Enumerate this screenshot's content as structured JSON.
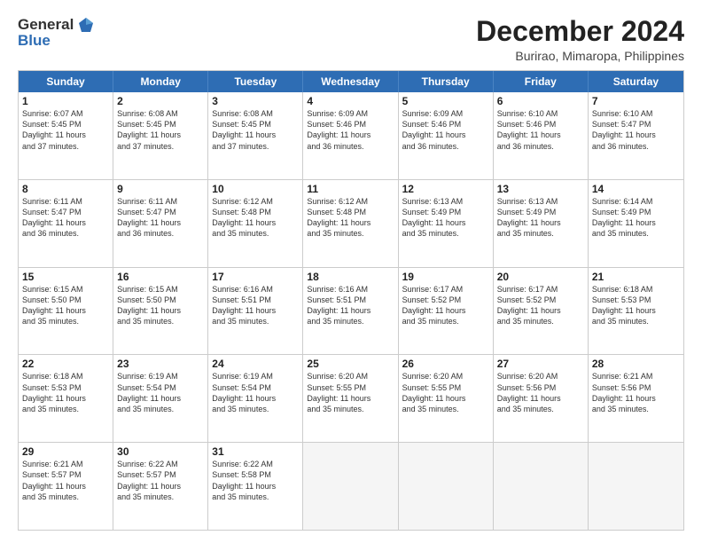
{
  "logo": {
    "general": "General",
    "blue": "Blue"
  },
  "title": "December 2024",
  "location": "Burirao, Mimaropa, Philippines",
  "days": [
    "Sunday",
    "Monday",
    "Tuesday",
    "Wednesday",
    "Thursday",
    "Friday",
    "Saturday"
  ],
  "rows": [
    [
      {
        "day": "1",
        "text": "Sunrise: 6:07 AM\nSunset: 5:45 PM\nDaylight: 11 hours\nand 37 minutes."
      },
      {
        "day": "2",
        "text": "Sunrise: 6:08 AM\nSunset: 5:45 PM\nDaylight: 11 hours\nand 37 minutes."
      },
      {
        "day": "3",
        "text": "Sunrise: 6:08 AM\nSunset: 5:45 PM\nDaylight: 11 hours\nand 37 minutes."
      },
      {
        "day": "4",
        "text": "Sunrise: 6:09 AM\nSunset: 5:46 PM\nDaylight: 11 hours\nand 36 minutes."
      },
      {
        "day": "5",
        "text": "Sunrise: 6:09 AM\nSunset: 5:46 PM\nDaylight: 11 hours\nand 36 minutes."
      },
      {
        "day": "6",
        "text": "Sunrise: 6:10 AM\nSunset: 5:46 PM\nDaylight: 11 hours\nand 36 minutes."
      },
      {
        "day": "7",
        "text": "Sunrise: 6:10 AM\nSunset: 5:47 PM\nDaylight: 11 hours\nand 36 minutes."
      }
    ],
    [
      {
        "day": "8",
        "text": "Sunrise: 6:11 AM\nSunset: 5:47 PM\nDaylight: 11 hours\nand 36 minutes."
      },
      {
        "day": "9",
        "text": "Sunrise: 6:11 AM\nSunset: 5:47 PM\nDaylight: 11 hours\nand 36 minutes."
      },
      {
        "day": "10",
        "text": "Sunrise: 6:12 AM\nSunset: 5:48 PM\nDaylight: 11 hours\nand 35 minutes."
      },
      {
        "day": "11",
        "text": "Sunrise: 6:12 AM\nSunset: 5:48 PM\nDaylight: 11 hours\nand 35 minutes."
      },
      {
        "day": "12",
        "text": "Sunrise: 6:13 AM\nSunset: 5:49 PM\nDaylight: 11 hours\nand 35 minutes."
      },
      {
        "day": "13",
        "text": "Sunrise: 6:13 AM\nSunset: 5:49 PM\nDaylight: 11 hours\nand 35 minutes."
      },
      {
        "day": "14",
        "text": "Sunrise: 6:14 AM\nSunset: 5:49 PM\nDaylight: 11 hours\nand 35 minutes."
      }
    ],
    [
      {
        "day": "15",
        "text": "Sunrise: 6:15 AM\nSunset: 5:50 PM\nDaylight: 11 hours\nand 35 minutes."
      },
      {
        "day": "16",
        "text": "Sunrise: 6:15 AM\nSunset: 5:50 PM\nDaylight: 11 hours\nand 35 minutes."
      },
      {
        "day": "17",
        "text": "Sunrise: 6:16 AM\nSunset: 5:51 PM\nDaylight: 11 hours\nand 35 minutes."
      },
      {
        "day": "18",
        "text": "Sunrise: 6:16 AM\nSunset: 5:51 PM\nDaylight: 11 hours\nand 35 minutes."
      },
      {
        "day": "19",
        "text": "Sunrise: 6:17 AM\nSunset: 5:52 PM\nDaylight: 11 hours\nand 35 minutes."
      },
      {
        "day": "20",
        "text": "Sunrise: 6:17 AM\nSunset: 5:52 PM\nDaylight: 11 hours\nand 35 minutes."
      },
      {
        "day": "21",
        "text": "Sunrise: 6:18 AM\nSunset: 5:53 PM\nDaylight: 11 hours\nand 35 minutes."
      }
    ],
    [
      {
        "day": "22",
        "text": "Sunrise: 6:18 AM\nSunset: 5:53 PM\nDaylight: 11 hours\nand 35 minutes."
      },
      {
        "day": "23",
        "text": "Sunrise: 6:19 AM\nSunset: 5:54 PM\nDaylight: 11 hours\nand 35 minutes."
      },
      {
        "day": "24",
        "text": "Sunrise: 6:19 AM\nSunset: 5:54 PM\nDaylight: 11 hours\nand 35 minutes."
      },
      {
        "day": "25",
        "text": "Sunrise: 6:20 AM\nSunset: 5:55 PM\nDaylight: 11 hours\nand 35 minutes."
      },
      {
        "day": "26",
        "text": "Sunrise: 6:20 AM\nSunset: 5:55 PM\nDaylight: 11 hours\nand 35 minutes."
      },
      {
        "day": "27",
        "text": "Sunrise: 6:20 AM\nSunset: 5:56 PM\nDaylight: 11 hours\nand 35 minutes."
      },
      {
        "day": "28",
        "text": "Sunrise: 6:21 AM\nSunset: 5:56 PM\nDaylight: 11 hours\nand 35 minutes."
      }
    ],
    [
      {
        "day": "29",
        "text": "Sunrise: 6:21 AM\nSunset: 5:57 PM\nDaylight: 11 hours\nand 35 minutes."
      },
      {
        "day": "30",
        "text": "Sunrise: 6:22 AM\nSunset: 5:57 PM\nDaylight: 11 hours\nand 35 minutes."
      },
      {
        "day": "31",
        "text": "Sunrise: 6:22 AM\nSunset: 5:58 PM\nDaylight: 11 hours\nand 35 minutes."
      },
      {
        "day": "",
        "text": ""
      },
      {
        "day": "",
        "text": ""
      },
      {
        "day": "",
        "text": ""
      },
      {
        "day": "",
        "text": ""
      }
    ]
  ]
}
